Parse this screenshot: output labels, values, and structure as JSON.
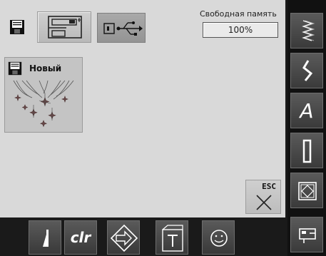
{
  "header": {
    "storage_icon": "floppy-disk-icon",
    "tabs": [
      {
        "id": "machine",
        "icon": "sewing-machine-icon",
        "active": true
      },
      {
        "id": "usb",
        "icon": "usb-stick-icon",
        "active": false
      }
    ]
  },
  "memory": {
    "label": "Свободная память",
    "value": "100%",
    "fraction": 1.0
  },
  "files": [
    {
      "name": "Новый",
      "icon": "floppy-disk-icon",
      "thumbnail": "embroidery-stars-thumbnail"
    }
  ],
  "esc_button": {
    "label": "ESC",
    "icon": "close-x-icon"
  },
  "sidebar": {
    "items": [
      {
        "id": "practical-stitches",
        "icon": "zigzag-stitch-icon"
      },
      {
        "id": "decorative-stitches",
        "icon": "decorative-stitch-icon"
      },
      {
        "id": "alphabets",
        "icon": "alphabet-icon",
        "glyph": "A"
      },
      {
        "id": "buttonholes",
        "icon": "buttonhole-icon"
      },
      {
        "id": "quilt-stitches",
        "icon": "quilt-icon"
      },
      {
        "id": "setup",
        "icon": "machine-setup-icon"
      }
    ]
  },
  "bottombar": {
    "items": [
      {
        "id": "pattern-begin",
        "icon": "pattern-begin-icon"
      },
      {
        "id": "clear",
        "icon": "clr-icon",
        "label": "clr"
      },
      {
        "id": "combination",
        "icon": "combination-mode-icon"
      },
      {
        "id": "tutorial",
        "icon": "tutorial-icon"
      },
      {
        "id": "favorites",
        "icon": "smiley-icon"
      }
    ]
  },
  "colors": {
    "screen_bg": "#d9d9d9",
    "frame_bg": "#1a1a1a",
    "button_dark": "#4a4a4a",
    "button_light": "#c8c8c8"
  }
}
